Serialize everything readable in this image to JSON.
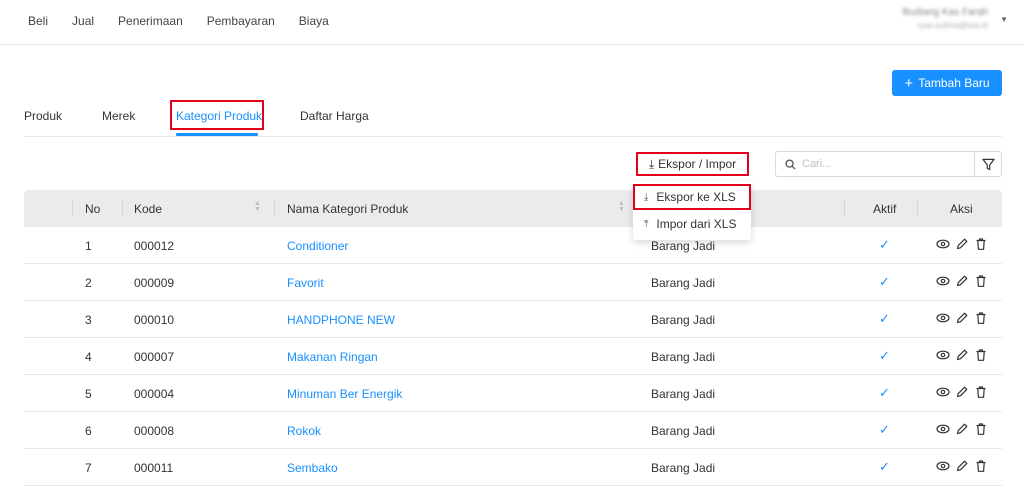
{
  "nav": {
    "items": [
      "Beli",
      "Jual",
      "Penerimaan",
      "Pembayaran",
      "Biaya"
    ]
  },
  "user": {
    "name": "Budiang Kas Farah",
    "email": "ryan.sutima@kas.id"
  },
  "actions": {
    "add_label": "Tambah Baru"
  },
  "tabs": [
    "Produk",
    "Merek",
    "Kategori Produk",
    "Daftar Harga"
  ],
  "toolbar": {
    "export_label": "Ekspor / Impor",
    "search_placeholder": "Cari..."
  },
  "dropdown": {
    "export_xls": "Ekspor ke XLS",
    "import_xls": "Impor dari XLS"
  },
  "table": {
    "columns": [
      "No",
      "Kode",
      "Nama Kategori Produk",
      "",
      "Aktif",
      "Aksi"
    ],
    "rows": [
      {
        "no": "1",
        "code": "000012",
        "name": "Conditioner",
        "type": "Barang Jadi",
        "active": true
      },
      {
        "no": "2",
        "code": "000009",
        "name": "Favorit",
        "type": "Barang Jadi",
        "active": true
      },
      {
        "no": "3",
        "code": "000010",
        "name": "HANDPHONE NEW",
        "type": "Barang Jadi",
        "active": true
      },
      {
        "no": "4",
        "code": "000007",
        "name": "Makanan Ringan",
        "type": "Barang Jadi",
        "active": true
      },
      {
        "no": "5",
        "code": "000004",
        "name": "Minuman Ber Energik",
        "type": "Barang Jadi",
        "active": true
      },
      {
        "no": "6",
        "code": "000008",
        "name": "Rokok",
        "type": "Barang Jadi",
        "active": true
      },
      {
        "no": "7",
        "code": "000011",
        "name": "Sembako",
        "type": "Barang Jadi",
        "active": true
      }
    ]
  },
  "colors": {
    "accent": "#1890ff",
    "highlight": "#e0001b",
    "header_bg": "#ebebeb"
  }
}
